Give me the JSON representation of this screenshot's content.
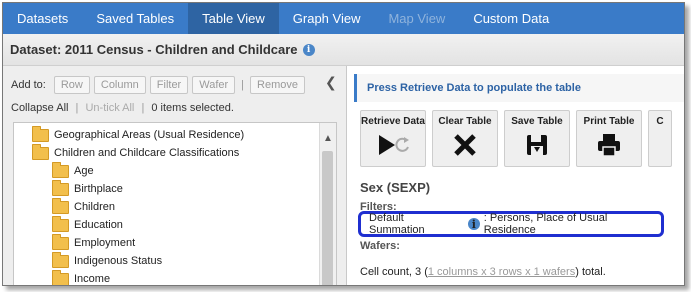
{
  "nav": {
    "tabs": [
      {
        "label": "Datasets"
      },
      {
        "label": "Saved Tables"
      },
      {
        "label": "Table View"
      },
      {
        "label": "Graph View"
      },
      {
        "label": "Map View"
      },
      {
        "label": "Custom Data"
      }
    ],
    "active_tab": "Table View",
    "disabled_tab": "Map View"
  },
  "dataset": {
    "title": "Dataset: 2011 Census - Children and Childcare"
  },
  "add_to": {
    "label": "Add to:",
    "buttons": [
      "Row",
      "Column",
      "Filter",
      "Wafer",
      "Remove"
    ],
    "separator": "|"
  },
  "selection": {
    "collapse_all": "Collapse All",
    "untick_all": "Un-tick All",
    "items_selected": "0 items selected.",
    "separator": "|"
  },
  "tree": {
    "items": [
      {
        "label": "Geographical Areas (Usual Residence)"
      },
      {
        "label": "Children and Childcare Classifications"
      },
      {
        "label": "Age"
      },
      {
        "label": "Birthplace"
      },
      {
        "label": "Children"
      },
      {
        "label": "Education"
      },
      {
        "label": "Employment"
      },
      {
        "label": "Indigenous Status"
      },
      {
        "label": "Income"
      }
    ]
  },
  "notice": {
    "text": "Press Retrieve Data to populate the table"
  },
  "toolbar": {
    "retrieve_label": "Retrieve Data",
    "clear_label": "Clear Table",
    "save_label": "Save Table",
    "print_label": "Print Table",
    "partial_label": "C"
  },
  "table": {
    "variable": "Sex (SEXP)",
    "filters_label": "Filters:",
    "filter_name": "Default Summation",
    "filter_value": ": Persons, Place of Usual Residence",
    "wafers_label": "Wafers:",
    "cell_count_prefix": "Cell count, 3 (",
    "cell_count_link": "1 columns x 3 rows x 1 wafers",
    "cell_count_suffix": ") total."
  },
  "colors": {
    "nav_bg": "#3a7bc8",
    "nav_active": "#2e64a3",
    "highlight_border": "#1f2fd0",
    "folder": "#f2bf4c",
    "notice_text": "#2d63a5"
  },
  "icons": {
    "info": "info-icon",
    "collapse": "chevron-left-icon",
    "scroll_up": "chevron-up-icon",
    "retrieve": "play-icon",
    "refresh": "refresh-icon",
    "clear": "close-icon",
    "save": "save-icon",
    "print": "print-icon",
    "folder": "folder-icon"
  }
}
